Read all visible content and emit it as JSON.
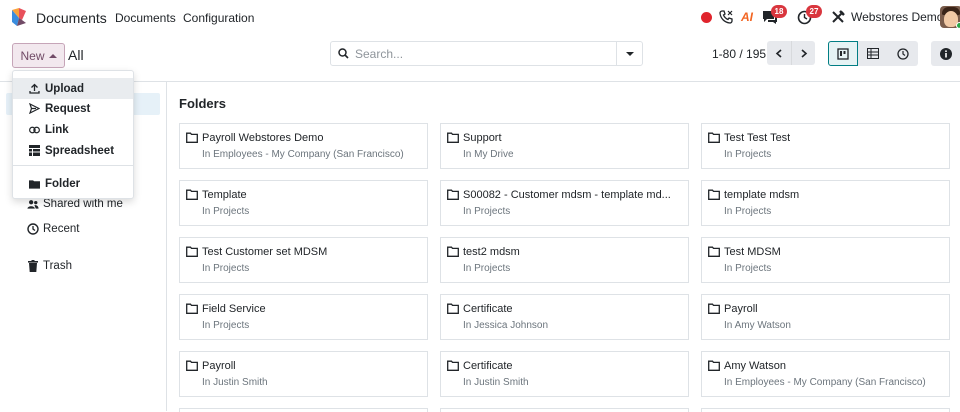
{
  "app": {
    "name": "Documents"
  },
  "nav": {
    "menu": [
      "Documents",
      "Configuration"
    ]
  },
  "systray": {
    "chat_count": "18",
    "activity_count": "27",
    "company": "Webstores Demo",
    "ai_label": "AI"
  },
  "control": {
    "new_label": "New",
    "breadcrumb": "All",
    "search_placeholder": "Search...",
    "pager": "1-80 / 195"
  },
  "new_menu": [
    {
      "label": "Upload",
      "icon": "upload-icon"
    },
    {
      "label": "Request",
      "icon": "send-icon"
    },
    {
      "label": "Link",
      "icon": "link-icon"
    },
    {
      "label": "Spreadsheet",
      "icon": "spreadsheet-icon"
    },
    {
      "label": "Folder",
      "icon": "folder-icon"
    }
  ],
  "sidebar": {
    "items": [
      {
        "label": "Shared with me",
        "icon": "users-icon"
      },
      {
        "label": "Recent",
        "icon": "clock-icon"
      },
      {
        "label": "Trash",
        "icon": "trash-icon"
      }
    ]
  },
  "main": {
    "title": "Folders",
    "folders": [
      {
        "name": "Payroll Webstores Demo",
        "location": "In Employees - My Company (San Francisco)"
      },
      {
        "name": "Support",
        "location": "In My Drive"
      },
      {
        "name": "Test Test Test",
        "location": "In Projects"
      },
      {
        "name": "Template",
        "location": "In Projects"
      },
      {
        "name": "S00082 - Customer mdsm - template md...",
        "location": "In Projects"
      },
      {
        "name": "template mdsm",
        "location": "In Projects"
      },
      {
        "name": "Test Customer set MDSM",
        "location": "In Projects"
      },
      {
        "name": "test2 mdsm",
        "location": "In Projects"
      },
      {
        "name": "Test MDSM",
        "location": "In Projects"
      },
      {
        "name": "Field Service",
        "location": "In Projects"
      },
      {
        "name": "Certificate",
        "location": "In Jessica Johnson"
      },
      {
        "name": "Payroll",
        "location": "In Amy Watson"
      },
      {
        "name": "Payroll",
        "location": "In Justin Smith"
      },
      {
        "name": "Certificate",
        "location": "In Justin Smith"
      },
      {
        "name": "Amy Watson",
        "location": "In Employees - My Company (San Francisco)"
      }
    ]
  },
  "colors": {
    "brand": "#714b67",
    "accent": "#017e84",
    "badge": "#d9363e",
    "recording": "#e0242c"
  }
}
